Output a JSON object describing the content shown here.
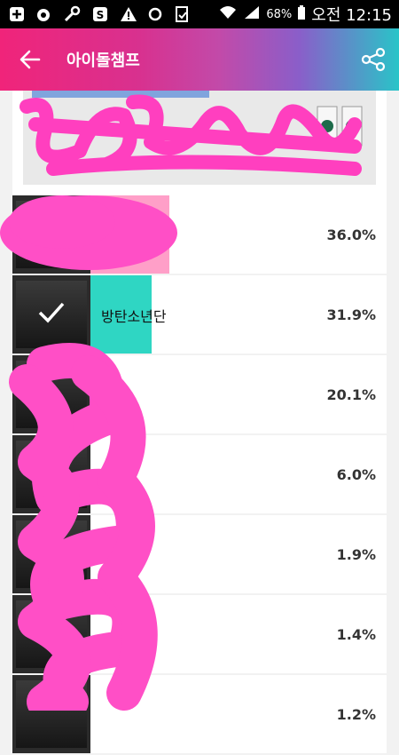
{
  "status_bar": {
    "battery_percent": "68%",
    "time": "오전 12:15"
  },
  "app_bar": {
    "title": "아이돌챔프"
  },
  "poll": {
    "rows": [
      {
        "name": "",
        "percent": "36.0%",
        "value": 36.0,
        "selected": false
      },
      {
        "name": "방탄소년단",
        "percent": "31.9%",
        "value": 31.9,
        "selected": true
      },
      {
        "name": "",
        "percent": "20.1%",
        "value": 20.1,
        "selected": false
      },
      {
        "name": "",
        "percent": "6.0%",
        "value": 6.0,
        "selected": false
      },
      {
        "name": "",
        "percent": "1.9%",
        "value": 1.9,
        "selected": false
      },
      {
        "name": "",
        "percent": "1.4%",
        "value": 1.4,
        "selected": false
      },
      {
        "name": "",
        "percent": "1.2%",
        "value": 1.2,
        "selected": false
      }
    ]
  },
  "colors": {
    "bar_teal": "#2fd6c3",
    "bar_pink": "#ff9fc8",
    "scribble": "#ff3fbf"
  }
}
